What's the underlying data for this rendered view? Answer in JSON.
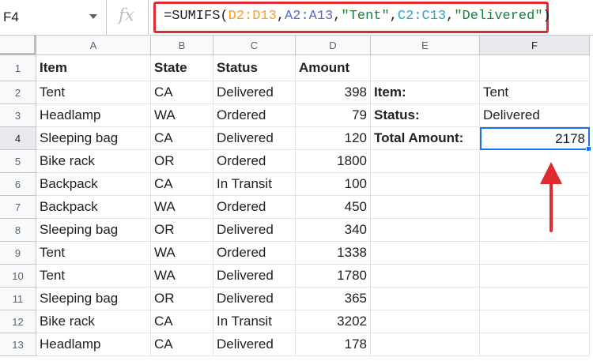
{
  "formula_bar": {
    "cell_ref": "F4",
    "fx_label": "fx",
    "formula_parts": [
      {
        "text": "=SUMIFS(",
        "cls": "t-fn"
      },
      {
        "text": "D2:D13",
        "cls": "t-r1"
      },
      {
        "text": ",",
        "cls": "t-fn"
      },
      {
        "text": "A2:A13",
        "cls": "t-r2"
      },
      {
        "text": ",",
        "cls": "t-fn"
      },
      {
        "text": "\"Tent\"",
        "cls": "t-str"
      },
      {
        "text": ",",
        "cls": "t-fn"
      },
      {
        "text": "C2:C13",
        "cls": "t-r3"
      },
      {
        "text": ",",
        "cls": "t-fn"
      },
      {
        "text": "\"Delivered\"",
        "cls": "t-str"
      },
      {
        "text": ")",
        "cls": "t-fn"
      }
    ]
  },
  "columns": [
    "A",
    "B",
    "C",
    "D",
    "E",
    "F"
  ],
  "active_column": "F",
  "active_row": 4,
  "rows": [
    {
      "num": "1",
      "cells": [
        "Item",
        "State",
        "Status",
        "Amount",
        "",
        ""
      ]
    },
    {
      "num": "2",
      "cells": [
        "Tent",
        "CA",
        "Delivered",
        "398",
        "Item:",
        "Tent"
      ]
    },
    {
      "num": "3",
      "cells": [
        "Headlamp",
        "WA",
        "Ordered",
        "79",
        "Status:",
        "Delivered"
      ]
    },
    {
      "num": "4",
      "cells": [
        "Sleeping bag",
        "CA",
        "Delivered",
        "120",
        "Total Amount:",
        "2178"
      ]
    },
    {
      "num": "5",
      "cells": [
        "Bike rack",
        "OR",
        "Ordered",
        "1800",
        "",
        ""
      ]
    },
    {
      "num": "6",
      "cells": [
        "Backpack",
        "CA",
        "In Transit",
        "100",
        "",
        ""
      ]
    },
    {
      "num": "7",
      "cells": [
        "Backpack",
        "WA",
        "Ordered",
        "450",
        "",
        ""
      ]
    },
    {
      "num": "8",
      "cells": [
        "Sleeping bag",
        "OR",
        "Delivered",
        "340",
        "",
        ""
      ]
    },
    {
      "num": "9",
      "cells": [
        "Tent",
        "WA",
        "Ordered",
        "1338",
        "",
        ""
      ]
    },
    {
      "num": "10",
      "cells": [
        "Tent",
        "WA",
        "Delivered",
        "1780",
        "",
        ""
      ]
    },
    {
      "num": "11",
      "cells": [
        "Sleeping bag",
        "OR",
        "Delivered",
        "365",
        "",
        ""
      ]
    },
    {
      "num": "12",
      "cells": [
        "Bike rack",
        "CA",
        "In Transit",
        "3202",
        "",
        ""
      ]
    },
    {
      "num": "13",
      "cells": [
        "Headlamp",
        "CA",
        "Delivered",
        "178",
        "",
        ""
      ]
    }
  ],
  "colors": {
    "highlight_red": "#e02a2f",
    "selection_blue": "#1a73e8"
  }
}
